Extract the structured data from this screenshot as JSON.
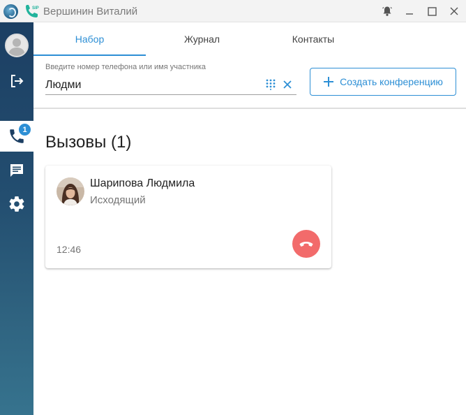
{
  "window": {
    "title": "Вершинин Виталий",
    "logo_icon": "app-logo-icon",
    "sip_icon": "sip-phone-icon",
    "controls": [
      "bell-icon",
      "minimize-icon",
      "maximize-icon",
      "close-icon"
    ]
  },
  "sidebar": {
    "items": [
      {
        "icon": "user-avatar",
        "active": false
      },
      {
        "icon": "logout-icon",
        "active": false
      },
      {
        "icon": "phone-icon",
        "active": true,
        "badge": "1"
      },
      {
        "icon": "chat-icon",
        "active": false
      },
      {
        "icon": "settings-icon",
        "active": false
      }
    ]
  },
  "tabs": [
    {
      "label": "Набор",
      "active": true
    },
    {
      "label": "Журнал",
      "active": false
    },
    {
      "label": "Контакты",
      "active": false
    }
  ],
  "search": {
    "label": "Введите номер телефона или имя участника",
    "value": "Людми"
  },
  "conference_button": {
    "label": "Создать конференцию",
    "icon": "plus-icon"
  },
  "calls": {
    "title": "Вызовы (1)",
    "items": [
      {
        "name": "Шарипова Людмила",
        "direction": "Исходящий",
        "time": "12:46",
        "hangup_icon": "hangup-icon"
      }
    ]
  },
  "colors": {
    "accent": "#2d8fd5",
    "hangup": "#f26b6b",
    "sidebar": "#1c3f63"
  }
}
